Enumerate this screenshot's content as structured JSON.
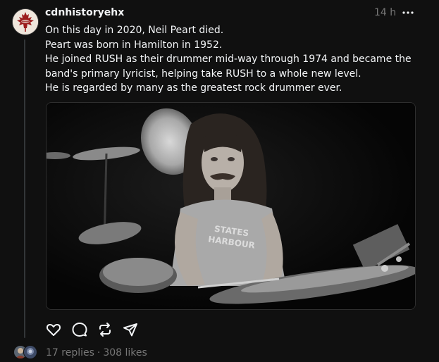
{
  "post": {
    "username": "cdnhistoryehx",
    "timestamp": "14 h",
    "text_lines": [
      "On this day in 2020, Neil Peart died.",
      "Peart was born in Hamilton in 1952.",
      "He joined RUSH as their drummer mid-way through 1974 and became the",
      "band's primary lyricist, helping take RUSH to a whole new level.",
      "He is regarded by many as the greatest rock drummer ever."
    ],
    "image": {
      "shirt_text_line1": "STATES",
      "shirt_text_line2": "HARBOUR"
    },
    "actions": [
      "heart-icon",
      "comment-icon",
      "repost-icon",
      "share-icon"
    ],
    "replies": "17 replies",
    "separator": "·",
    "likes": "308 likes"
  },
  "colors": {
    "background": "#101010",
    "text": "#f3f5f7",
    "muted": "#777777",
    "thread_line": "#333638",
    "avatar_maple": "#9b1c1c"
  }
}
